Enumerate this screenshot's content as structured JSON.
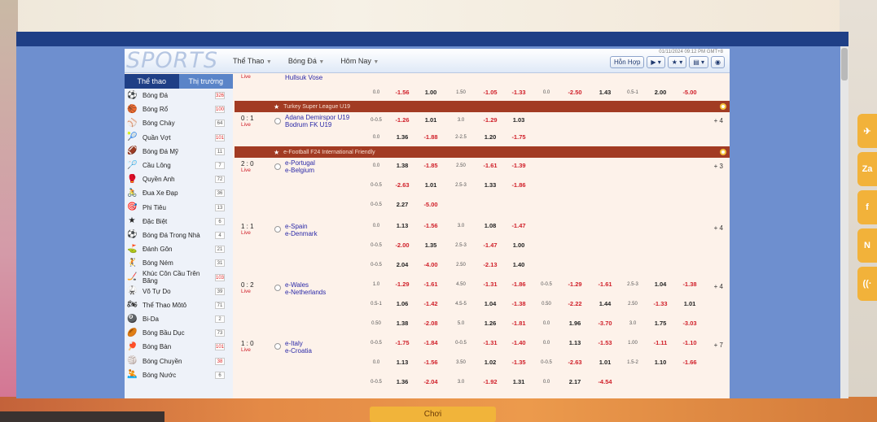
{
  "header": {
    "logo": "SPORTS",
    "menu": [
      "Thể Thao",
      "Bóng Đá",
      "Hôm Nay"
    ],
    "date": "01/11/2024 09:12 PM GMT+8",
    "mixed_button": "Hỗn Hợp"
  },
  "sidebar": {
    "tabs": [
      "Thể thao",
      "Thị trường"
    ],
    "items": [
      {
        "label": "Bóng Đá",
        "count": "326",
        "icon": "soccer-icon",
        "glyph": "⚽",
        "hot": true
      },
      {
        "label": "Bóng Rổ",
        "count": "100",
        "icon": "basketball-icon",
        "glyph": "🏀",
        "hot": true
      },
      {
        "label": "Bóng Chày",
        "count": "64",
        "icon": "baseball-icon",
        "glyph": "⚾",
        "hot": false
      },
      {
        "label": "Quần Vợt",
        "count": "101",
        "icon": "tennis-icon",
        "glyph": "🎾",
        "hot": true
      },
      {
        "label": "Bóng Đá Mỹ",
        "count": "11",
        "icon": "american-football-icon",
        "glyph": "🏈",
        "hot": false
      },
      {
        "label": "Cầu Lông",
        "count": "7",
        "icon": "badminton-icon",
        "glyph": "🏸",
        "hot": false
      },
      {
        "label": "Quyền Anh",
        "count": "72",
        "icon": "boxing-icon",
        "glyph": "🥊",
        "hot": false
      },
      {
        "label": "Đua Xe Đạp",
        "count": "36",
        "icon": "cycling-icon",
        "glyph": "🚴",
        "hot": false
      },
      {
        "label": "Phi Tiêu",
        "count": "13",
        "icon": "darts-icon",
        "glyph": "🎯",
        "hot": false
      },
      {
        "label": "Đặc Biệt",
        "count": "6",
        "icon": "special-icon",
        "glyph": "★",
        "hot": false
      },
      {
        "label": "Bóng Đá Trong Nhà",
        "count": "4",
        "icon": "futsal-icon",
        "glyph": "⚽",
        "hot": false
      },
      {
        "label": "Đánh Gôn",
        "count": "21",
        "icon": "golf-icon",
        "glyph": "⛳",
        "hot": false
      },
      {
        "label": "Bóng Ném",
        "count": "31",
        "icon": "handball-icon",
        "glyph": "🤾",
        "hot": false
      },
      {
        "label": "Khúc Côn Cầu Trên Băng",
        "count": "103",
        "icon": "ice-hockey-icon",
        "glyph": "🏒",
        "hot": true
      },
      {
        "label": "Võ Tự Do",
        "count": "39",
        "icon": "mma-icon",
        "glyph": "🥋",
        "hot": false
      },
      {
        "label": "Thể Thao Môtô",
        "count": "71",
        "icon": "motorsport-icon",
        "glyph": "🏍",
        "hot": false
      },
      {
        "label": "Bi-Da",
        "count": "2",
        "icon": "billiards-icon",
        "glyph": "🎱",
        "hot": false
      },
      {
        "label": "Bóng Bầu Dục",
        "count": "73",
        "icon": "rugby-icon",
        "glyph": "🏉",
        "hot": false
      },
      {
        "label": "Bóng Bàn",
        "count": "101",
        "icon": "table-tennis-icon",
        "glyph": "🏓",
        "hot": true
      },
      {
        "label": "Bóng Chuyền",
        "count": "38",
        "icon": "volleyball-icon",
        "glyph": "🏐",
        "hot": true
      },
      {
        "label": "Bóng Nước",
        "count": "6",
        "icon": "water-polo-icon",
        "glyph": "🤽",
        "hot": false
      }
    ]
  },
  "leagues": [
    {
      "name": "Turkey Super League U19"
    },
    {
      "name": "e-Football F24 International Friendly"
    }
  ],
  "matches": {
    "m0": {
      "home": "Hullsuk Vose",
      "live": "Live"
    },
    "m1": {
      "score": "0 : 1",
      "live": "Live",
      "home": "Adana Demirspor U19",
      "away": "Bodrum FK U19",
      "more": "+ 4"
    },
    "m2": {
      "score": "2 : 0",
      "live": "Live",
      "home": "e-Portugal",
      "away": "e-Belgium",
      "more": "+ 3"
    },
    "m3": {
      "score": "1 : 1",
      "live": "Live",
      "home": "e-Spain",
      "away": "e-Denmark",
      "more": "+ 4"
    },
    "m4": {
      "score": "0 : 2",
      "live": "Live",
      "home": "e-Wales",
      "away": "e-Netherlands",
      "more": "+ 4"
    },
    "m5": {
      "score": "1 : 0",
      "live": "Live",
      "home": "e-Italy",
      "away": "e-Croatia",
      "more": "+ 7"
    }
  },
  "odds_rows": [
    [
      "0.0",
      "-1.56",
      "1.00",
      "1.50",
      "-1.05",
      "-1.33",
      "0.0",
      "-2.50",
      "1.43",
      "0.5-1",
      "2.00",
      "-5.00"
    ],
    [
      "0-0.5",
      "-1.26",
      "1.01",
      "3.0",
      "-1.29",
      "1.03",
      "",
      "",
      "",
      "",
      "",
      ""
    ],
    [
      "0.0",
      "1.36",
      "-1.88",
      "2-2.5",
      "1.20",
      "-1.75",
      "",
      "",
      "",
      "",
      "",
      ""
    ],
    [
      "0.0",
      "1.38",
      "-1.85",
      "2.50",
      "-1.61",
      "-1.39",
      "",
      "",
      "",
      "",
      "",
      ""
    ],
    [
      "0-0.5",
      "-2.63",
      "1.01",
      "2.5-3",
      "1.33",
      "-1.86",
      "",
      "",
      "",
      "",
      "",
      ""
    ],
    [
      "0-0.5",
      "2.27",
      "-5.00",
      "",
      "",
      "",
      "",
      "",
      "",
      "",
      "",
      ""
    ],
    [
      "0.0",
      "1.13",
      "-1.56",
      "3.0",
      "1.08",
      "-1.47",
      "",
      "",
      "",
      "",
      "",
      ""
    ],
    [
      "0-0.5",
      "-2.00",
      "1.35",
      "2.5-3",
      "-1.47",
      "1.00",
      "",
      "",
      "",
      "",
      "",
      ""
    ],
    [
      "0-0.5",
      "2.04",
      "-4.00",
      "2.50",
      "-2.13",
      "1.40",
      "",
      "",
      "",
      "",
      "",
      ""
    ],
    [
      "1.0",
      "-1.29",
      "-1.61",
      "4.50",
      "-1.31",
      "-1.86",
      "0-0.5",
      "-1.29",
      "-1.61",
      "2.5-3",
      "1.04",
      "-1.38"
    ],
    [
      "0.5-1",
      "1.06",
      "-1.42",
      "4.5-5",
      "1.04",
      "-1.38",
      "0.50",
      "-2.22",
      "1.44",
      "2.50",
      "-1.33",
      "1.01"
    ],
    [
      "0.50",
      "1.38",
      "-2.08",
      "5.0",
      "1.26",
      "-1.81",
      "0.0",
      "1.96",
      "-3.70",
      "3.0",
      "1.75",
      "-3.03"
    ],
    [
      "0-0.5",
      "-1.75",
      "-1.84",
      "0-0.5",
      "-1.31",
      "-1.40",
      "0.0",
      "1.13",
      "-1.53",
      "1.00",
      "-1.11",
      "-1.10"
    ],
    [
      "0.0",
      "1.13",
      "-1.56",
      "3.50",
      "1.02",
      "-1.35",
      "0-0.5",
      "-2.63",
      "1.01",
      "1.5-2",
      "1.10",
      "-1.66"
    ],
    [
      "0-0.5",
      "1.36",
      "-2.04",
      "3.0",
      "-1.92",
      "1.31",
      "0.0",
      "2.17",
      "-4.54",
      "",
      "",
      ""
    ]
  ],
  "bottom": {
    "button": "Chơi"
  },
  "widgets": [
    "✈",
    "Za",
    "f",
    "N",
    "((·"
  ]
}
